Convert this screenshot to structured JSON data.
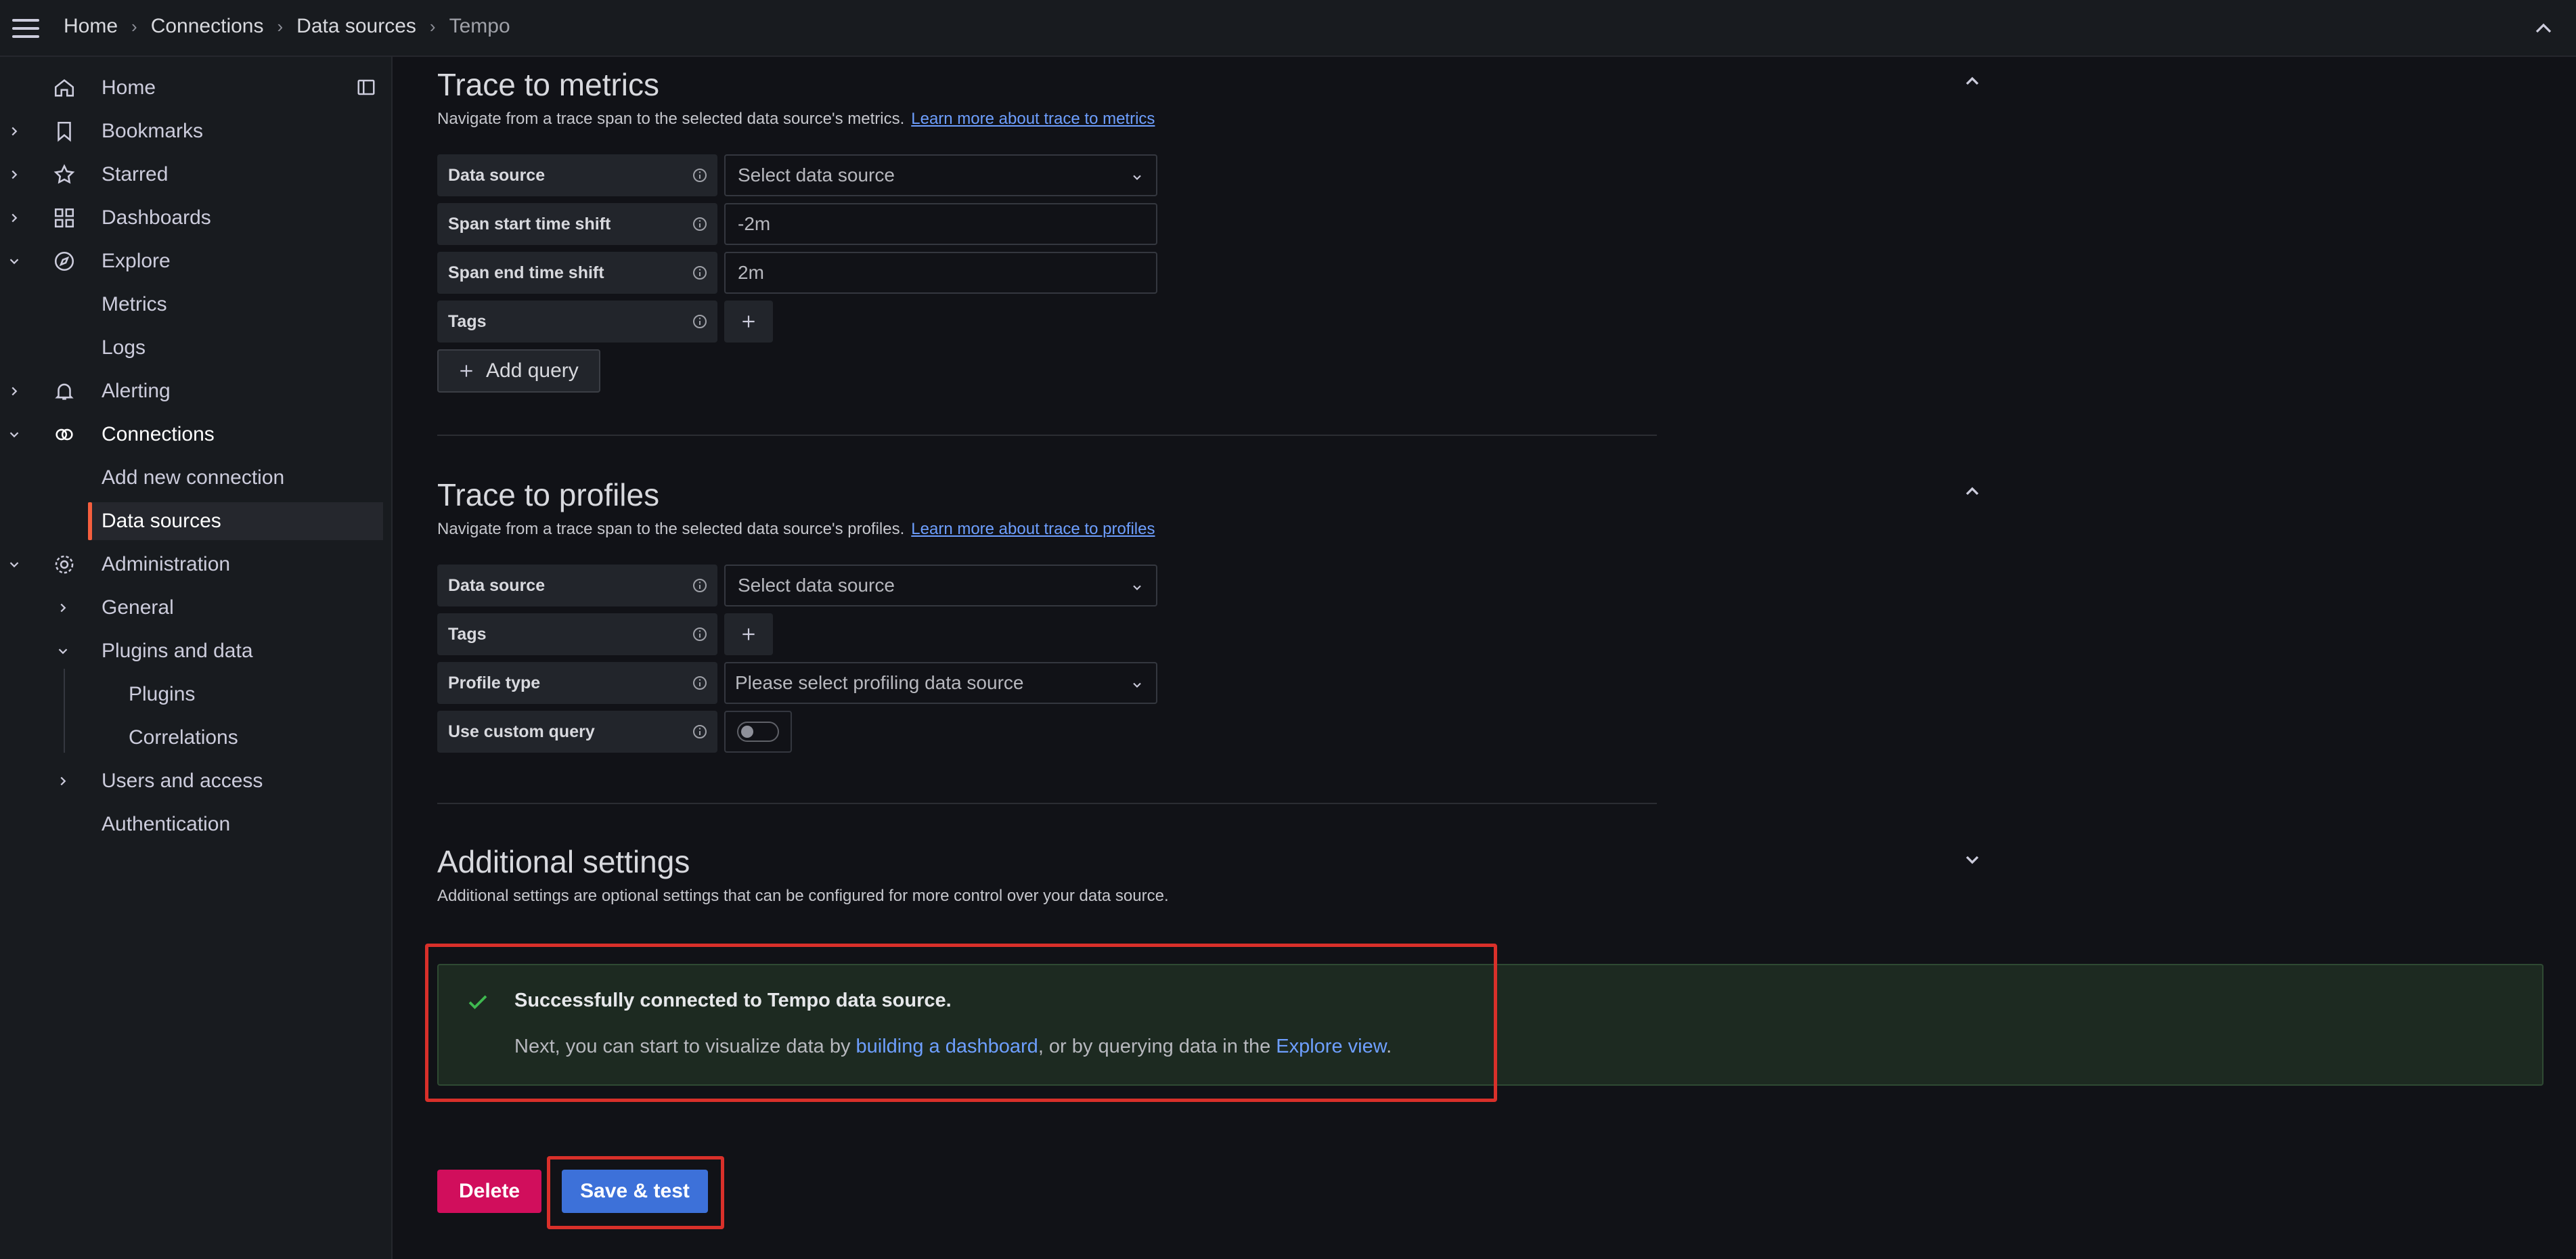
{
  "topbar": {
    "breadcrumb": [
      "Home",
      "Connections",
      "Data sources",
      "Tempo"
    ]
  },
  "sidebar": {
    "items": [
      {
        "label": "Home",
        "icon": "home-icon"
      },
      {
        "label": "Bookmarks",
        "icon": "bookmark-icon"
      },
      {
        "label": "Starred",
        "icon": "star-icon"
      },
      {
        "label": "Dashboards",
        "icon": "apps-icon"
      },
      {
        "label": "Explore",
        "icon": "compass-icon"
      },
      {
        "label": "Metrics"
      },
      {
        "label": "Logs"
      },
      {
        "label": "Alerting",
        "icon": "bell-icon"
      },
      {
        "label": "Connections",
        "icon": "link-icon"
      },
      {
        "label": "Add new connection"
      },
      {
        "label": "Data sources"
      },
      {
        "label": "Administration",
        "icon": "cog-icon"
      },
      {
        "label": "General"
      },
      {
        "label": "Plugins and data"
      },
      {
        "label": "Plugins"
      },
      {
        "label": "Correlations"
      },
      {
        "label": "Users and access"
      },
      {
        "label": "Authentication"
      }
    ]
  },
  "trace_to_metrics": {
    "title": "Trace to metrics",
    "description": "Navigate from a trace span to the selected data source's metrics.",
    "link": "Learn more about trace to metrics",
    "fields": {
      "data_source_label": "Data source",
      "data_source_placeholder": "Select data source",
      "span_start_label": "Span start time shift",
      "span_start_value": "-2m",
      "span_end_label": "Span end time shift",
      "span_end_value": "2m",
      "tags_label": "Tags"
    },
    "add_query_label": "Add query"
  },
  "trace_to_profiles": {
    "title": "Trace to profiles",
    "description": "Navigate from a trace span to the selected data source's profiles.",
    "link": "Learn more about trace to profiles",
    "fields": {
      "data_source_label": "Data source",
      "data_source_placeholder": "Select data source",
      "tags_label": "Tags",
      "profile_type_label": "Profile type",
      "profile_type_placeholder": "Please select profiling data source",
      "custom_query_label": "Use custom query",
      "custom_query_enabled": false
    }
  },
  "additional_settings": {
    "title": "Additional settings",
    "description": "Additional settings are optional settings that can be configured for more control over your data source."
  },
  "alert": {
    "title": "Successfully connected to Tempo data source.",
    "body_prefix": "Next, you can start to visualize data by ",
    "link_dashboard": "building a dashboard",
    "body_middle": ", or by querying data in the ",
    "link_explore": "Explore view",
    "body_suffix": "."
  },
  "actions": {
    "delete_label": "Delete",
    "save_label": "Save & test"
  },
  "colors": {
    "accent_orange": "#f55f3e",
    "primary_blue": "#3d71d9",
    "delete_pink": "#d10e5c",
    "success_green": "#3fb950",
    "highlight_red": "#d9302a"
  }
}
